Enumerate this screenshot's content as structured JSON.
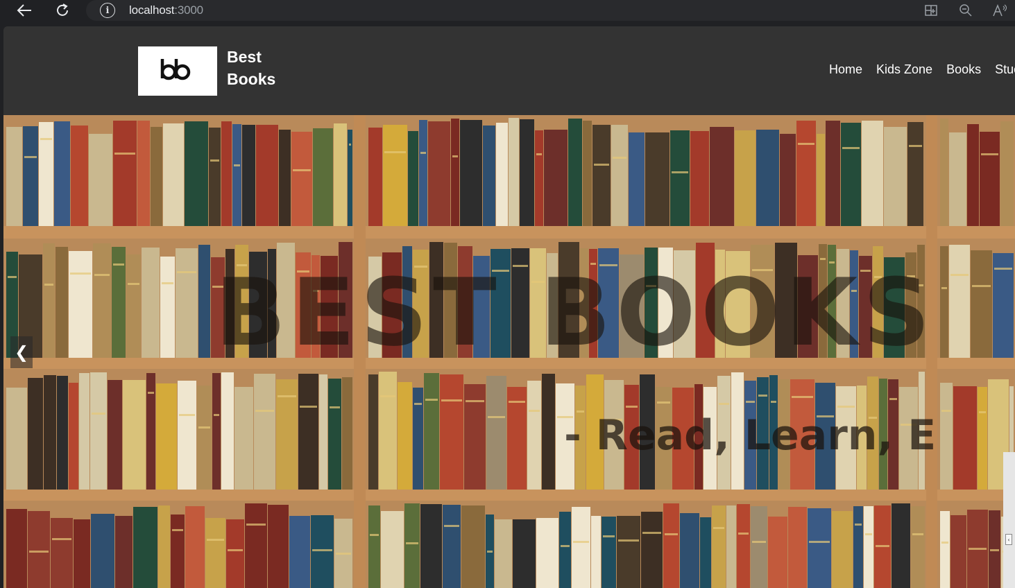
{
  "browser": {
    "url_host": "localhost",
    "url_port": ":3000"
  },
  "navbar": {
    "logo_text": "bb",
    "brand_line1": "Best",
    "brand_line2": "Books",
    "links": [
      "Home",
      "Kids Zone",
      "Books",
      "Stuc"
    ]
  },
  "hero": {
    "title": "BEST BOOKS",
    "subtitle": "- Read, Learn, E",
    "prev_label": "❮"
  }
}
